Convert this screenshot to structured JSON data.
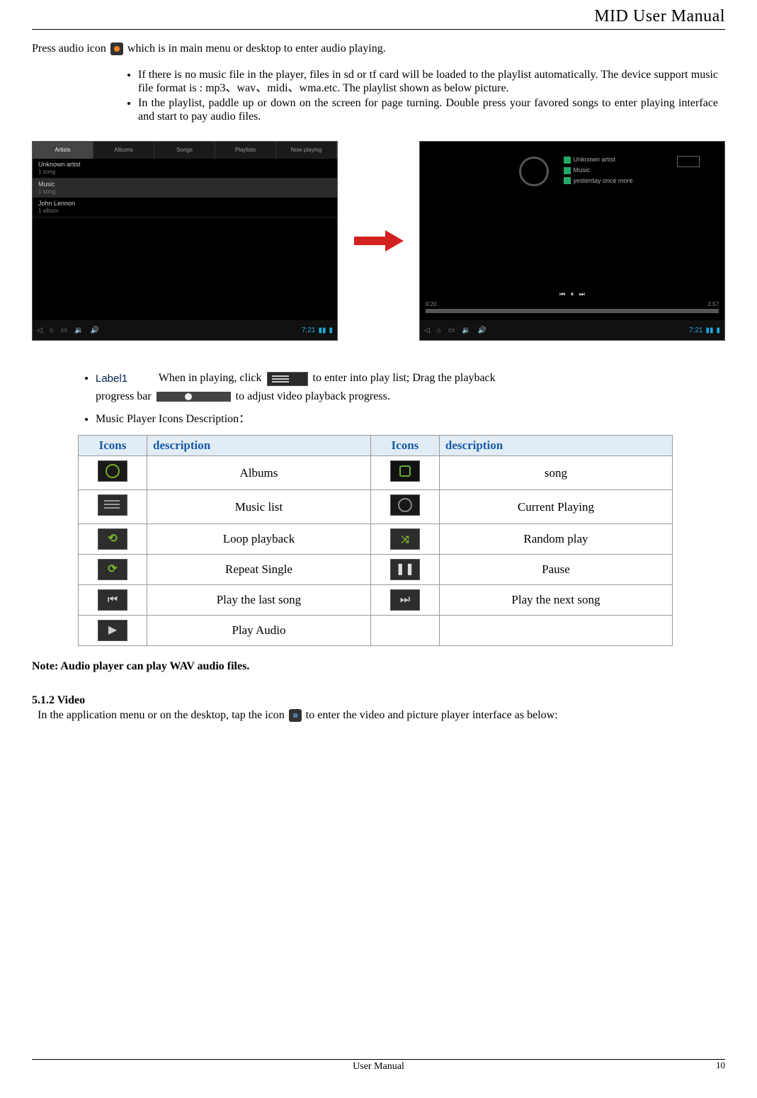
{
  "header": {
    "title": "MID User Manual"
  },
  "intro": {
    "line1_a": "Press audio icon",
    "line1_b": "which is in main menu or desktop to enter audio playing."
  },
  "bullets_top": [
    "If there is no music file in the player, files in sd or tf card will be loaded to the playlist automatically. The device support music file format is : mp3、wav、midi、wma.etc. The playlist shown as below picture.",
    "In the playlist, paddle up or down on the screen for page turning. Double press your favored songs to enter playing interface and start to pay audio files."
  ],
  "screenshot1": {
    "tabs": [
      "Artists",
      "Albums",
      "Songs",
      "Playlists",
      "Now playing"
    ],
    "rows": [
      {
        "title": "Unknown artist",
        "sub": "1 song"
      },
      {
        "title": "Music",
        "sub": "1 song"
      },
      {
        "title": "John Lennon",
        "sub": "1 album"
      }
    ],
    "clock": "7:21"
  },
  "screenshot2": {
    "entries": [
      "Unknown artist",
      "Music",
      "yesterday once more"
    ],
    "time_left": "0:20",
    "time_right": "2:57",
    "clock": "7:21"
  },
  "lower": {
    "label": "Label1",
    "line_a": "When in playing, click",
    "line_b": "to enter into play list; Drag the playback",
    "line_c": "progress bar",
    "line_d": "to adjust video playback progress.",
    "line2": "Music Player Icons Description："
  },
  "table": {
    "h1": "Icons",
    "h2": "description",
    "h3": "Icons",
    "h4": "description",
    "rows": [
      {
        "d1": "Albums",
        "d2": "song"
      },
      {
        "d1": "Music list",
        "d2": "Current Playing"
      },
      {
        "d1": "Loop playback",
        "d2": "Random play"
      },
      {
        "d1": "Repeat Single",
        "d2": "Pause"
      },
      {
        "d1": "Play the last song",
        "d2": "Play the next song"
      },
      {
        "d1": "Play Audio",
        "d2": ""
      }
    ]
  },
  "note": "Note: Audio player can play WAV audio files.",
  "video": {
    "heading": "5.1.2 Video",
    "para_a": "In the application menu or on the desktop, tap the icon",
    "para_b": "to enter the video and picture player interface as below:"
  },
  "footer": {
    "text": "User Manual",
    "page": "10"
  }
}
